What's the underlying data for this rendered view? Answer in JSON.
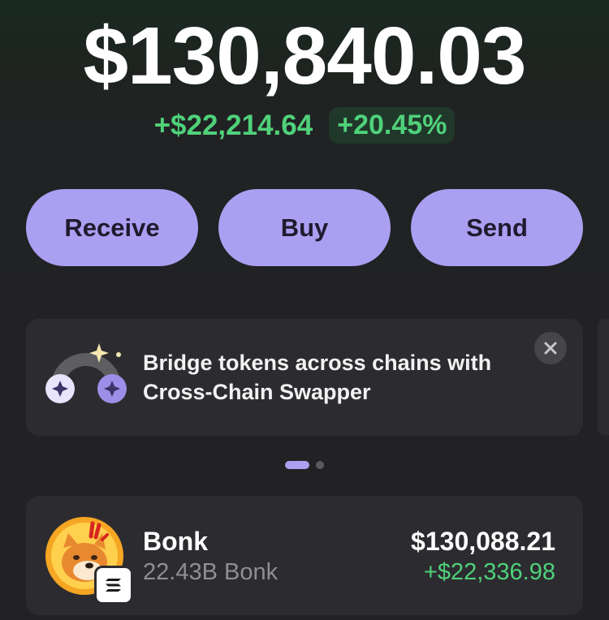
{
  "portfolio": {
    "balance": "$130,840.03",
    "change_amount": "+$22,214.64",
    "change_percent": "+20.45%"
  },
  "actions": {
    "receive_label": "Receive",
    "buy_label": "Buy",
    "send_label": "Send"
  },
  "promo": {
    "text": "Bridge tokens across chains with Cross-Chain Swapper",
    "close_icon": "close-icon",
    "pager": {
      "count": 2,
      "active": 1
    }
  },
  "tokens": [
    {
      "name": "Bonk",
      "balance": "22.43B Bonk",
      "value": "$130,088.21",
      "change": "+$22,336.98",
      "chain_icon": "solana-icon"
    }
  ],
  "colors": {
    "accent": "#ab9ff2",
    "positive": "#4fd17a",
    "card": "#2c2c30",
    "background": "#222224"
  }
}
